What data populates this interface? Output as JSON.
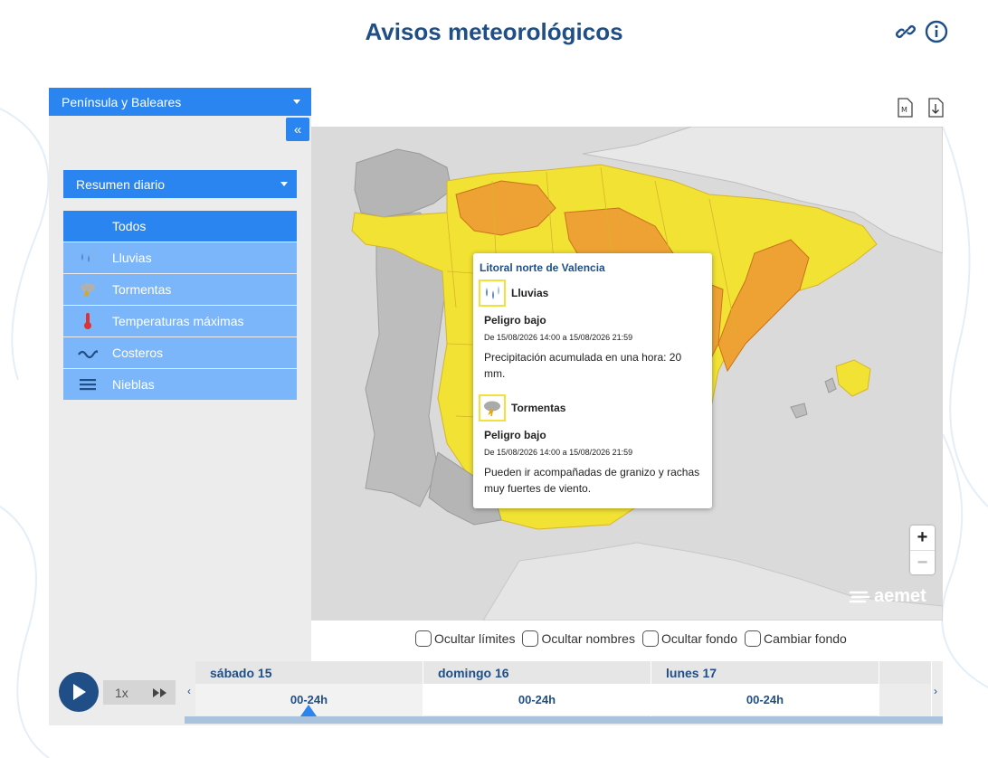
{
  "page": {
    "title": "Avisos meteorológicos",
    "top_icons": [
      "link-icon",
      "info-icon"
    ]
  },
  "sidebar": {
    "region_select": "Península y Baleares",
    "collapse_label": "«",
    "mode_select": "Resumen diario",
    "items": [
      {
        "label": "Todos",
        "icon": "none",
        "active": true
      },
      {
        "label": "Lluvias",
        "icon": "rain-icon",
        "active": false
      },
      {
        "label": "Tormentas",
        "icon": "storm-icon",
        "active": false
      },
      {
        "label": "Temperaturas máximas",
        "icon": "thermometer-icon",
        "active": false
      },
      {
        "label": "Costeros",
        "icon": "wave-icon",
        "active": false
      },
      {
        "label": "Nieblas",
        "icon": "fog-icon",
        "active": false
      }
    ]
  },
  "map": {
    "doc_icons": [
      "pdf-map-icon",
      "download-icon"
    ],
    "popup": {
      "region": "Litoral norte de Valencia",
      "warnings": [
        {
          "name": "Lluvias",
          "icon": "rain-icon",
          "level": "Peligro bajo",
          "dates": "De 15/08/2026 14:00 a 15/08/2026 21:59",
          "description": "Precipitación acumulada en una hora: 20 mm."
        },
        {
          "name": "Tormentas",
          "icon": "storm-icon",
          "level": "Peligro bajo",
          "dates": "De 15/08/2026 14:00 a 15/08/2026 21:59",
          "description": "Pueden ir acompañadas de granizo y rachas muy fuertes de viento."
        }
      ]
    },
    "zoom_in": "+",
    "zoom_out": "−",
    "logo": "aemet",
    "colors": {
      "yellow": "#f2e233",
      "orange": "#efa234",
      "grey": "#b5b5b5",
      "sea": "#dadada"
    }
  },
  "options": {
    "hide_limits": "Ocultar límites",
    "hide_names": "Ocultar nombres",
    "hide_background": "Ocultar fondo",
    "change_background": "Cambiar fondo"
  },
  "timeline": {
    "speed": "1x",
    "days": [
      {
        "label": "sábado 15",
        "slot": "00-24h",
        "selected": true
      },
      {
        "label": "domingo 16",
        "slot": "00-24h",
        "selected": false
      },
      {
        "label": "lunes 17",
        "slot": "00-24h",
        "selected": false
      }
    ]
  },
  "accent_colors": {
    "primary": "#2a85f0",
    "light": "#7cb6fa",
    "title": "#1f4f86"
  }
}
